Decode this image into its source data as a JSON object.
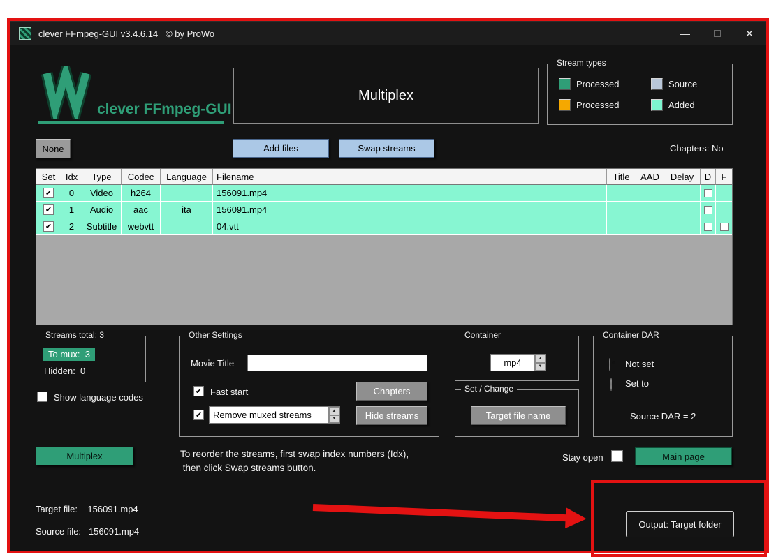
{
  "glyphs": {
    "check": "✔",
    "up": "▲",
    "down": "▼",
    "minimize": "—",
    "close": "✕"
  },
  "titlebar": {
    "title": "clever FFmpeg-GUI v3.4.6.14   © by ProWo"
  },
  "header": {
    "logo_text": "clever FFmpeg-GUI",
    "page_title": "Multiplex",
    "stream_types": {
      "title": "Stream types",
      "items": [
        {
          "label": "Processed",
          "color": "#2f9e77"
        },
        {
          "label": "Source",
          "color": "#b9c7d9"
        },
        {
          "label": "Processed",
          "color": "#f5a800"
        },
        {
          "label": "Added",
          "color": "#7df5cf"
        }
      ]
    }
  },
  "toolbar": {
    "none_button": "None",
    "add_files_button": "Add files",
    "swap_streams_button": "Swap streams",
    "chapters_status": "Chapters: No"
  },
  "table": {
    "columns": [
      "Set",
      "Idx",
      "Type",
      "Codec",
      "Language",
      "Filename",
      "Title",
      "AAD",
      "Delay",
      "D",
      "F"
    ],
    "rows": [
      {
        "idx": "0",
        "type": "Video",
        "codec": "h264",
        "language": "",
        "filename": "156091.mp4",
        "title": "",
        "aad": "",
        "delay": ""
      },
      {
        "idx": "1",
        "type": "Audio",
        "codec": "aac",
        "language": "ita",
        "filename": "156091.mp4",
        "title": "",
        "aad": "",
        "delay": ""
      },
      {
        "idx": "2",
        "type": "Subtitle",
        "codec": "webvtt",
        "language": "",
        "filename": "04.vtt",
        "title": "",
        "aad": "",
        "delay": ""
      }
    ]
  },
  "streams_panel": {
    "title": "Streams total: 3",
    "to_mux": "To mux:  3",
    "hidden": "Hidden:  0",
    "show_language_codes_label": "Show language codes"
  },
  "other_settings": {
    "title": "Other Settings",
    "movie_title_label": "Movie Title",
    "movie_title_value": "",
    "fast_start_label": "Fast start",
    "chapters_button": "Chapters",
    "remove_muxed_label": "Remove muxed streams",
    "hide_streams_button": "Hide streams"
  },
  "container_panel": {
    "title": "Container",
    "format": "mp4"
  },
  "set_change_panel": {
    "title": "Set / Change",
    "target_file_name_button": "Target file name"
  },
  "container_dar": {
    "title": "Container DAR",
    "not_set_label": "Not set",
    "set_to_label": "Set to",
    "source_dar": "Source DAR = 2"
  },
  "actions": {
    "multiplex_button": "Multiplex",
    "instruction_line1": "To reorder the streams, first swap index numbers (Idx),",
    "instruction_line2": " then click Swap streams button.",
    "stay_open_label": "Stay open",
    "main_page_button": "Main page"
  },
  "footer": {
    "target_file": "Target file:    156091.mp4",
    "source_file": "Source file:   156091.mp4",
    "output_button": "Output: Target folder"
  }
}
